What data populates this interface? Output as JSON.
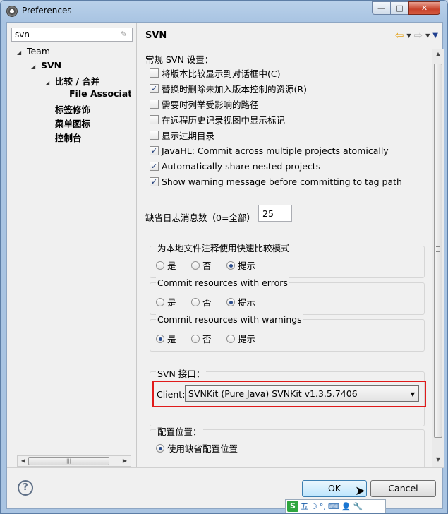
{
  "window": {
    "title": "Preferences",
    "minimize_label": "—",
    "maximize_label": "□",
    "close_label": "✕"
  },
  "filter": {
    "value": "svn"
  },
  "tree": {
    "team": "Team",
    "svn": "SVN",
    "compare_merge": "比较 / 合并",
    "file_assoc": "File Associatic",
    "label_decor": "标签修饰",
    "menu_icons": "菜单图标",
    "console": "控制台"
  },
  "page": {
    "title": "SVN",
    "general_settings": "常规 SVN 设置：",
    "checkboxes": [
      {
        "label": "将版本比较显示到对话框中(C)",
        "checked": false
      },
      {
        "label": "替换时删除未加入版本控制的资源(R)",
        "checked": true
      },
      {
        "label": "需要时列举受影响的路径",
        "checked": false
      },
      {
        "label": "在远程历史记录视图中显示标记",
        "checked": false
      },
      {
        "label": "显示过期目录",
        "checked": false
      },
      {
        "label": "JavaHL: Commit across multiple projects atomically",
        "checked": true
      },
      {
        "label": "Automatically share nested projects",
        "checked": true
      },
      {
        "label": "Show warning message before committing to tag path",
        "checked": true
      }
    ],
    "log_messages_label": "缺省日志消息数（0=全部）",
    "log_messages_value": "25",
    "groups": [
      {
        "label": "为本地文件注释使用快速比较模式",
        "options": [
          "是",
          "否",
          "提示"
        ],
        "selected": 2
      },
      {
        "label": "Commit resources with errors",
        "options": [
          "是",
          "否",
          "提示"
        ],
        "selected": 2
      },
      {
        "label": "Commit resources with warnings",
        "options": [
          "是",
          "否",
          "提示"
        ],
        "selected": 0
      }
    ],
    "svn_interface_label": "SVN 接口：",
    "client_label": "Client:",
    "client_value": "SVNKit (Pure Java) SVNKit v1.3.5.7406",
    "config_location_label": "配置位置：",
    "use_default_config": "使用缺省配置位置"
  },
  "buttons": {
    "help": "?",
    "ok": "OK",
    "cancel": "Cancel"
  },
  "ime": {
    "logo": "S",
    "mode": "五",
    "items": [
      "☽",
      "°,",
      "⌨",
      "👤",
      "🔧"
    ]
  },
  "colors": {
    "highlight_border": "#e01b1b",
    "ok_button": "#bee6fd"
  }
}
